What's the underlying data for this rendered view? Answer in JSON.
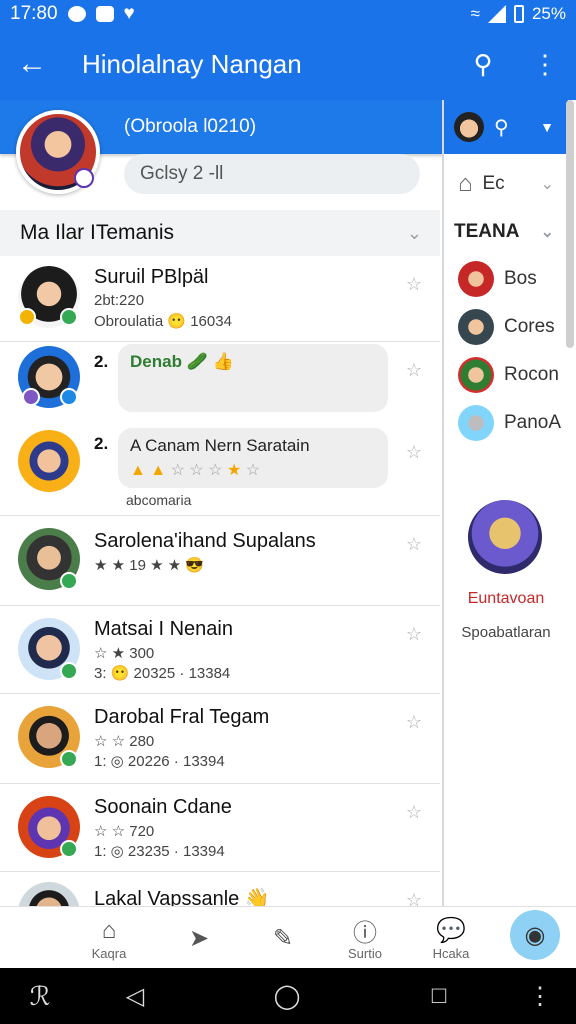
{
  "status_bar": {
    "time": "17:80",
    "battery": "25%"
  },
  "app_bar": {
    "title": "Hinolalnay Nangan",
    "back_icon": "arrow-left-icon",
    "search_icon": "search-icon",
    "more_icon": "more-vert-icon"
  },
  "profile": {
    "band_text": "(Obroola l0210)",
    "search_text": "Gclsy 2 -ll"
  },
  "section": {
    "title": "Ma Ilar ITemanis"
  },
  "contacts": [
    {
      "name": "Suruil PBlpäl",
      "line1": "2bt:220",
      "line2": "Obroulatia  😶 16034"
    },
    {
      "num": "2.",
      "bubble": "Denab"
    },
    {
      "num": "2.",
      "bubble": "A Canam Nern Saratain",
      "caption": "abcomaria"
    },
    {
      "name": "Sarolena'ihand Supalans",
      "line1": "★  ★  19 ★ ★ 😎"
    },
    {
      "name": "Matsai I Nenain",
      "line1": "☆  ★  300",
      "line2": "3:  😶  20325 · 13384"
    },
    {
      "name": "Darobal Fral Tegam",
      "line1": "☆  ☆  280",
      "line2": "1:  ◎  20226 · 13394"
    },
    {
      "name": "Soonain Cdane",
      "line1": "☆  ☆  720",
      "line2": "1:  ◎  23235 · 13394"
    },
    {
      "name": "Lakal Vapssanle 👋"
    }
  ],
  "right_panel": {
    "row1": "Ec",
    "header": "TEANA",
    "people": [
      "Bos",
      "Cores",
      "Rocon",
      "PanoA"
    ],
    "featured_name": "Euntavoan",
    "featured_sub": "Spoabatlaran"
  },
  "bottom_nav": [
    {
      "label": "Kaqra",
      "icon": "home-icon"
    },
    {
      "label": "",
      "icon": "forward-icon"
    },
    {
      "label": "",
      "icon": "edit-icon"
    },
    {
      "label": "Surtio",
      "icon": "info-icon"
    },
    {
      "label": "Hcaka",
      "icon": "chat-icon"
    }
  ],
  "colors": {
    "primary": "#1a73e8",
    "accent_fab": "#8ed1f5",
    "gold": "#f2a600"
  }
}
